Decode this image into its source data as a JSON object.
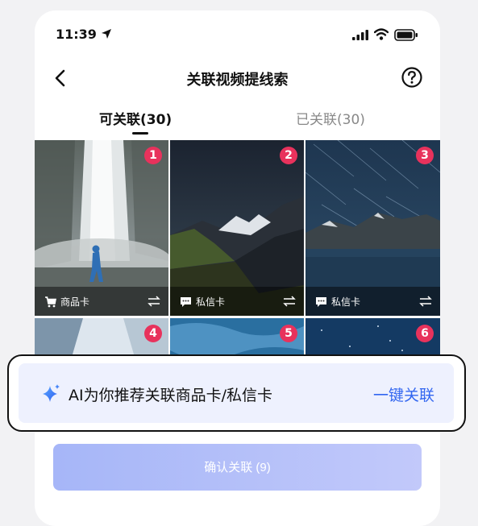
{
  "status_bar": {
    "time": "11:39",
    "icons": [
      "location-arrow-icon",
      "signal-icon",
      "wifi-icon",
      "battery-icon"
    ]
  },
  "nav": {
    "title": "关联视频提线索",
    "back_icon": "chevron-left-icon",
    "help_icon": "question-circle-icon"
  },
  "tabs": [
    {
      "label": "可关联(30)",
      "active": true
    },
    {
      "label": "已关联(30)",
      "active": false
    }
  ],
  "tiles": [
    {
      "badge": "1",
      "card_label": "商品卡",
      "card_icon": "shopping-cart-icon"
    },
    {
      "badge": "2",
      "card_label": "私信卡",
      "card_icon": "message-icon"
    },
    {
      "badge": "3",
      "card_label": "私信卡",
      "card_icon": "message-icon"
    },
    {
      "badge": "4"
    },
    {
      "badge": "5"
    },
    {
      "badge": "6"
    }
  ],
  "callout": {
    "text": "AI为你推荐关联商品卡/私信卡",
    "link": "一键关联",
    "icon": "sparkle-icon"
  },
  "confirm_button": {
    "label": "确认关联 (9)"
  },
  "colors": {
    "badge": "#e8325c",
    "link": "#3266f0",
    "button": "#a6b6f8",
    "callout_bg": "#eef1fe"
  }
}
